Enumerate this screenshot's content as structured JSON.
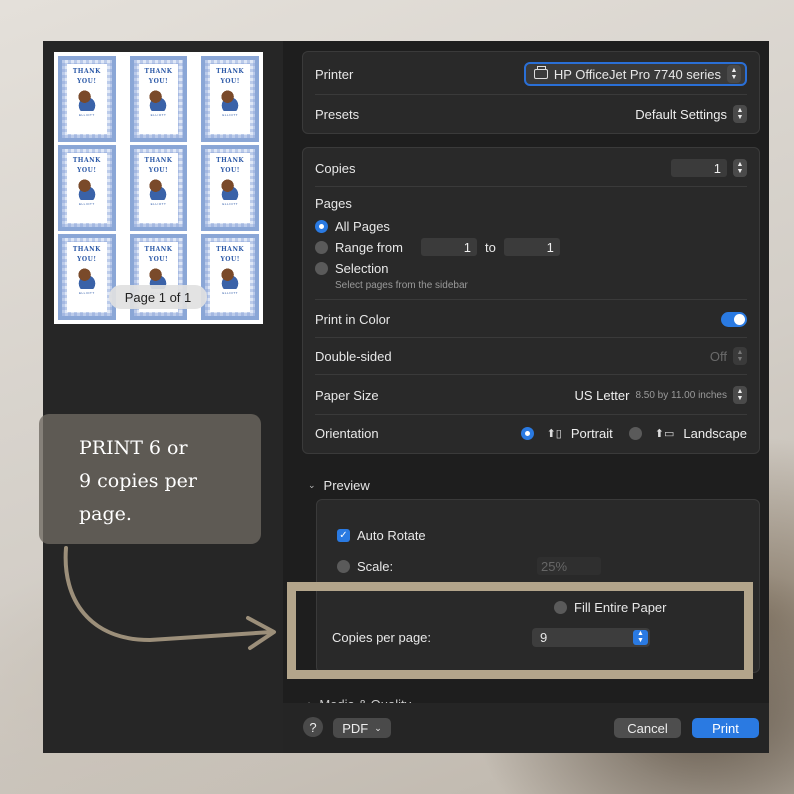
{
  "sidebar": {
    "page_indicator": "Page 1 of 1",
    "tags": {
      "line1": "THANK",
      "line2": "YOU!",
      "name": "ELLIOTT"
    }
  },
  "printer": {
    "label": "Printer",
    "value": "HP OfficeJet Pro 7740 series"
  },
  "presets": {
    "label": "Presets",
    "value": "Default Settings"
  },
  "copies": {
    "label": "Copies",
    "value": "1"
  },
  "pages": {
    "label": "Pages",
    "all": "All Pages",
    "range": "Range from",
    "range_from": "1",
    "to": "to",
    "range_to": "1",
    "selection": "Selection",
    "selection_hint": "Select pages from the sidebar"
  },
  "color": {
    "label": "Print in Color",
    "on": true
  },
  "double_sided": {
    "label": "Double-sided",
    "value": "Off"
  },
  "paper": {
    "label": "Paper Size",
    "value": "US Letter",
    "detail": "8.50 by 11.00 inches"
  },
  "orientation": {
    "label": "Orientation",
    "portrait": "Portrait",
    "landscape": "Landscape",
    "selected": "portrait"
  },
  "preview": {
    "header": "Preview",
    "auto_rotate": "Auto Rotate",
    "scale": "Scale:",
    "scale_value": "25%",
    "fill": "Fill Entire Paper",
    "copies_label": "Copies per page:",
    "copies_value": "9"
  },
  "media": {
    "header": "Media & Quality"
  },
  "footer": {
    "help": "?",
    "pdf": "PDF",
    "cancel": "Cancel",
    "print": "Print"
  },
  "callout": {
    "text": "PRINT  6  or\n9 copies per\npage."
  },
  "colors": {
    "accent": "#2a7ae2",
    "highlight": "#b3a58b"
  }
}
